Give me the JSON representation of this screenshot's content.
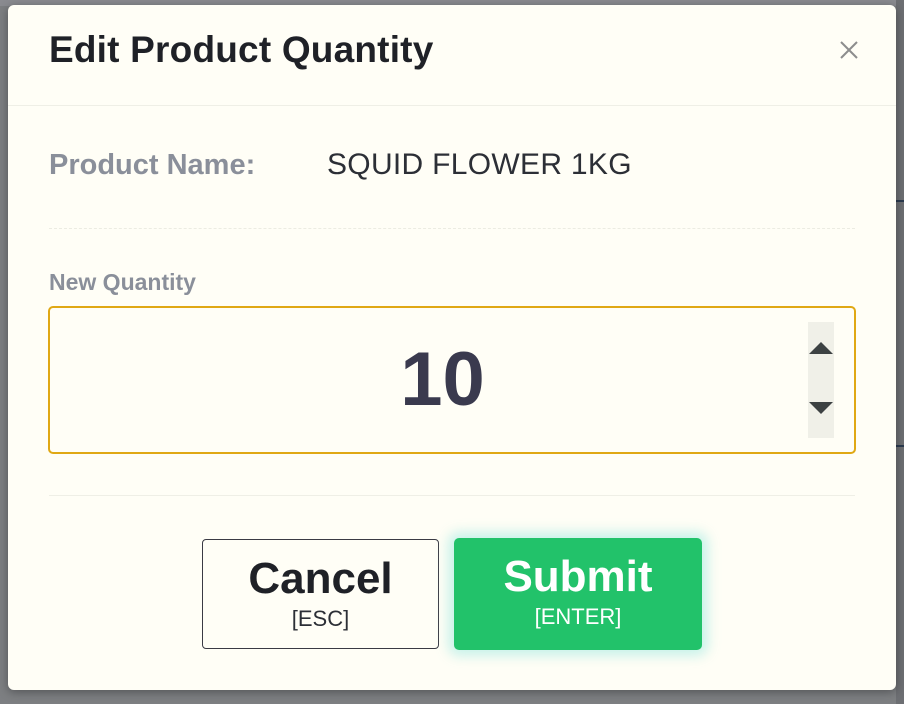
{
  "dialog": {
    "title": "Edit Product Quantity",
    "close_icon": "close-icon"
  },
  "product": {
    "label": "Product Name:",
    "value": "SQUID FLOWER 1KG"
  },
  "quantity": {
    "label": "New Quantity",
    "value": "10",
    "increment_icon": "triangle-up-icon",
    "decrement_icon": "triangle-down-icon",
    "border_color": "#e0a814"
  },
  "buttons": {
    "cancel": {
      "label": "Cancel",
      "shortcut": "[ESC]"
    },
    "submit": {
      "label": "Submit",
      "shortcut": "[ENTER]",
      "color": "#22c26a"
    }
  }
}
